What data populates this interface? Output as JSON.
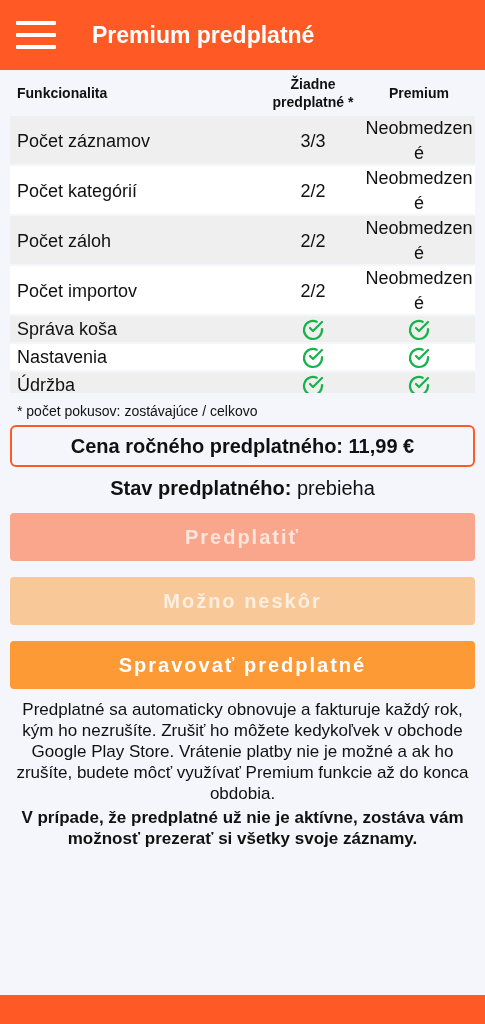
{
  "app_bar": {
    "title": "Premium predplatné"
  },
  "table": {
    "columns": [
      "Funkcionalita",
      "Žiadne predplatné *",
      "Premium"
    ],
    "rows": [
      {
        "feature": "Počet záznamov",
        "free": {
          "kind": "text",
          "text": "3/3"
        },
        "premium": {
          "kind": "text",
          "text": "Neobmedzené"
        }
      },
      {
        "feature": "Počet kategórií",
        "free": {
          "kind": "text",
          "text": "2/2"
        },
        "premium": {
          "kind": "text",
          "text": "Neobmedzené"
        }
      },
      {
        "feature": "Počet záloh",
        "free": {
          "kind": "text",
          "text": "2/2"
        },
        "premium": {
          "kind": "text",
          "text": "Neobmedzené"
        }
      },
      {
        "feature": "Počet importov",
        "free": {
          "kind": "text",
          "text": "2/2"
        },
        "premium": {
          "kind": "text",
          "text": "Neobmedzené"
        }
      },
      {
        "feature": "Správa koša",
        "free": {
          "kind": "check"
        },
        "premium": {
          "kind": "check"
        }
      },
      {
        "feature": "Nastavenia",
        "free": {
          "kind": "check"
        },
        "premium": {
          "kind": "check"
        }
      },
      {
        "feature": "Údržba",
        "free": {
          "kind": "check"
        },
        "premium": {
          "kind": "check"
        }
      }
    ]
  },
  "footnote": "* počet pokusov: zostávajúce / celkovo",
  "price": "Cena ročného predplatného: 11,99 €",
  "status": {
    "label": "Stav predplatného:",
    "value": "prebieha"
  },
  "buttons": [
    {
      "label": "Predplatiť",
      "kind": "primary",
      "disabled": true
    },
    {
      "label": "Možno neskôr",
      "kind": "accent",
      "disabled": true
    },
    {
      "label": "Spravovať predplatné",
      "kind": "accent",
      "disabled": false
    }
  ],
  "info": "Predplatné sa automaticky obnovuje a fakturuje každý rok, kým ho nezrušíte. Zrušiť ho môžete kedykoľvek v obchode Google Play Store. Vrátenie platby nie je možné a ak ho zrušíte, budete môcť využívať Premium funkcie až do konca obdobia.",
  "note": "V prípade, že predplatné už nie je aktívne, zostáva vám možnosť prezerať si všetky svoje záznamy."
}
